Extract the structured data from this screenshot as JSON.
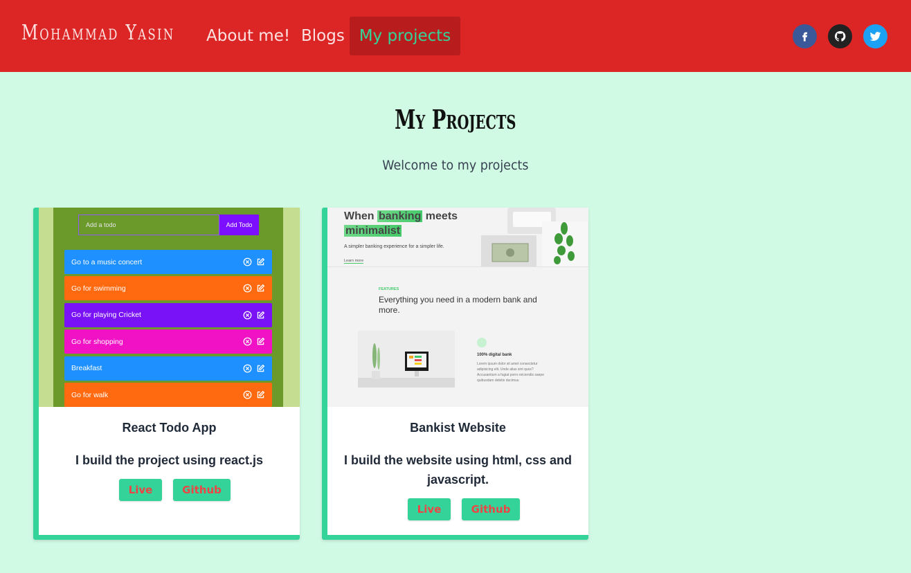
{
  "header": {
    "brand": "Mohammad Yasin",
    "nav": [
      {
        "label": "About me!"
      },
      {
        "label": "Blogs"
      },
      {
        "label": "My projects"
      }
    ],
    "social": [
      {
        "icon": "facebook-icon"
      },
      {
        "icon": "github-icon"
      },
      {
        "icon": "twitter-icon"
      }
    ]
  },
  "page": {
    "title": "My Projects",
    "subtitle": "Welcome to my projects"
  },
  "colors": {
    "header_bg": "#dc2626",
    "page_bg": "#d1fae5",
    "accent": "#34d399",
    "button_text": "#ef4444"
  },
  "projects": [
    {
      "title": "React Todo App",
      "description": "I build the project using react.js",
      "live_label": "Live",
      "github_label": "Github",
      "thumbnail": {
        "input_placeholder": "Add a todo",
        "add_button": "Add Todo",
        "todos": [
          {
            "text": "Go to a music concert",
            "color": "#1e90ff"
          },
          {
            "text": "Go for swimming",
            "color": "#ff6a10"
          },
          {
            "text": "Go for playing Cricket",
            "color": "#7a12f7"
          },
          {
            "text": "Go for shopping",
            "color": "#f012c4"
          },
          {
            "text": "Breakfast",
            "color": "#1e90ff"
          },
          {
            "text": "Go for walk",
            "color": "#ff6a10"
          }
        ]
      }
    },
    {
      "title": "Bankist Website",
      "description": "I build the website using html, css and javascript.",
      "live_label": "Live",
      "github_label": "Github",
      "thumbnail": {
        "headline_1": "When",
        "headline_hl1": "banking",
        "headline_2": "meets",
        "headline_hl2": "minimalist",
        "subtext": "A simpler banking experience for a simpler life.",
        "learn_more": "Learn more",
        "features_label": "FEATURES",
        "features_heading": "Everything you need in a modern bank and more.",
        "feature_title": "100% digital bank",
        "feature_text": "Lorem ipsum dolor sit amet consectetur adipisicing elit. Unde alias sint quos? Accusantium a fugiat porro reiciendis saepe quibusdam debitis ducimus."
      }
    }
  ]
}
